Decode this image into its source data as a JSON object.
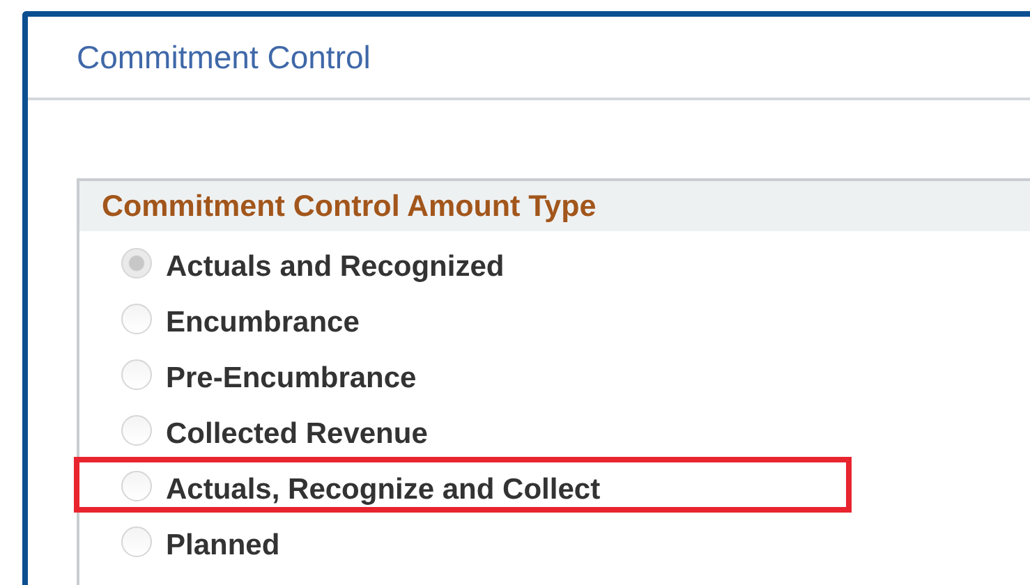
{
  "page": {
    "title": "Commitment Control"
  },
  "group": {
    "title": "Commitment Control Amount Type",
    "options": [
      {
        "label": "Actuals and Recognized",
        "selected": true,
        "highlighted": false
      },
      {
        "label": "Encumbrance",
        "selected": false,
        "highlighted": false
      },
      {
        "label": "Pre-Encumbrance",
        "selected": false,
        "highlighted": false
      },
      {
        "label": "Collected Revenue",
        "selected": false,
        "highlighted": false
      },
      {
        "label": "Actuals, Recognize and Collect",
        "selected": false,
        "highlighted": true
      },
      {
        "label": "Planned",
        "selected": false,
        "highlighted": false
      }
    ]
  }
}
